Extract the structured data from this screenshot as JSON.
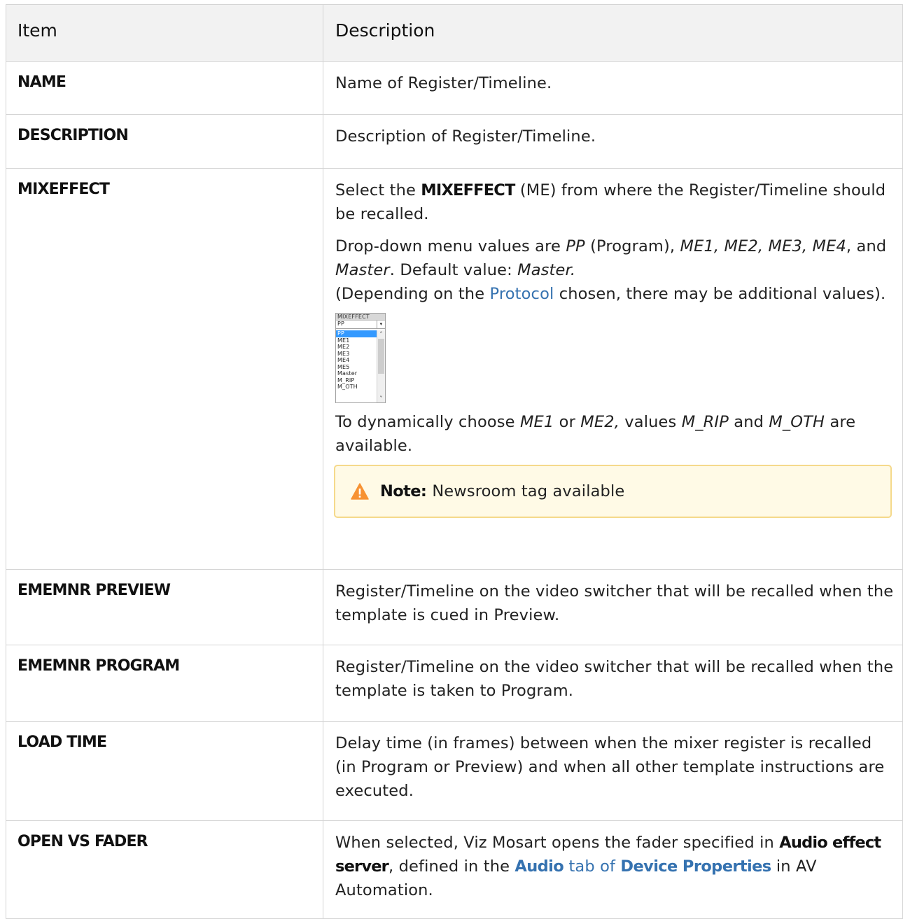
{
  "headers": {
    "item": "Item",
    "description": "Description"
  },
  "rows": [
    {
      "key": "NAME",
      "desc": "Name of Register/Timeline."
    },
    {
      "key": "DESCRIPTION",
      "desc": "Description of Register/Timeline."
    },
    {
      "key": "MIXEFFECT"
    },
    {
      "key": "EMEMNR PREVIEW",
      "desc": "Register/Timeline on the video switcher that will be recalled when the template is cued in Preview."
    },
    {
      "key": "EMEMNR PROGRAM",
      "desc": "Register/Timeline on the video switcher that will be recalled when the template is taken to Program."
    },
    {
      "key": "LOAD TIME",
      "desc": "Delay time (in frames) between when the mixer register is recalled (in Program or Preview) and when all other template instructions are executed."
    },
    {
      "key": "OPEN VS FADER"
    }
  ],
  "mixeffect": {
    "p1_a": "Select the ",
    "p1_b": "MIXEFFECT",
    "p1_c": " (ME) from where the Register/Timeline should be recalled.",
    "p2_a": "Drop-down menu values are ",
    "p2_pp": "PP",
    "p2_b": " (Program), ",
    "p2_vals": "ME1, ME2, ME3, ME4",
    "p2_c": ", and ",
    "p2_master": "Master",
    "p2_d": ". Default value: ",
    "p2_default": "Master.",
    "p2_e": "(Depending on the ",
    "p2_link": "Protocol",
    "p2_f": " chosen, there may be additional values).",
    "p3_a": "To dynamically choose ",
    "p3_me1": "ME1",
    "p3_or": " or ",
    "p3_me2": "ME2,",
    "p3_b": " values ",
    "p3_rip": "M_RIP",
    "p3_and": " and ",
    "p3_oth": "M_OTH",
    "p3_c": " are available.",
    "note_label": "Note:",
    "note_text": "Newsroom tag available",
    "dropdown": {
      "header": "MIXEFFECT",
      "selected": "PP",
      "options": [
        "PP",
        "ME1",
        "ME2",
        "ME3",
        "ME4",
        "ME5",
        "Master",
        "M_RIP",
        "M_OTH"
      ]
    }
  },
  "fader": {
    "a": "When selected, Viz Mosart opens the fader specified in ",
    "b": "Audio effect server",
    "c": ", defined in the ",
    "link1": "Audio",
    "link2": " tab of ",
    "link3": "Device Properties",
    "d": " in AV Automation."
  },
  "colors": {
    "link": "#3572b0",
    "header_bg": "#f2f2f2",
    "note_bg": "#fffae6",
    "note_border": "#f5d98b",
    "warn": "#f79232",
    "border": "#d4d4d4"
  },
  "icons": {
    "note": "warning-triangle-icon"
  }
}
